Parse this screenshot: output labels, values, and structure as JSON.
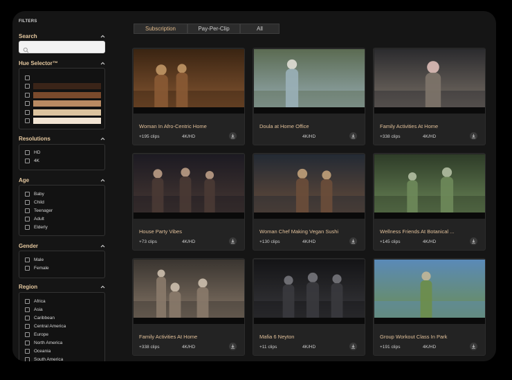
{
  "sidebar": {
    "title": "FILTERS",
    "search": {
      "label": "Search",
      "placeholder": "",
      "value": ""
    },
    "hue": {
      "label": "Hue Selector™",
      "swatches": [
        "#121212",
        "#3a2418",
        "#7a4a2c",
        "#b98a62",
        "#dcc39e",
        "#f1e4d3"
      ]
    },
    "resolutions": {
      "label": "Resolutions",
      "options": [
        "HD",
        "4K"
      ]
    },
    "age": {
      "label": "Age",
      "options": [
        "Baby",
        "Child",
        "Teenager",
        "Adult",
        "Elderly"
      ]
    },
    "gender": {
      "label": "Gender",
      "options": [
        "Male",
        "Female"
      ]
    },
    "region": {
      "label": "Region",
      "options": [
        "Africa",
        "Asia",
        "Caribbean",
        "Central America",
        "Europe",
        "North America",
        "Oceania",
        "South America"
      ]
    }
  },
  "tabs": [
    {
      "label": "Subscription",
      "active": true
    },
    {
      "label": "Pay-Per-Clip",
      "active": false
    },
    {
      "label": "All",
      "active": false
    }
  ],
  "cards": [
    {
      "title": "Woman In Afro-Centric Home",
      "clips": "+195 clips",
      "res": "4K/HD",
      "scene": [
        "#3a2412",
        "#8a5a34",
        "#c79c6a"
      ]
    },
    {
      "title": "Doula at Home Office",
      "clips": "",
      "res": "4K/HD",
      "scene": [
        "#5b6b52",
        "#9ab0b8",
        "#e8e4dc"
      ]
    },
    {
      "title": "Family Activities At Home",
      "clips": "+338 clips",
      "res": "4K/HD",
      "scene": [
        "#2b2b2e",
        "#7e746a",
        "#e8c6c0"
      ]
    },
    {
      "title": "House Party Vibes",
      "clips": "+73 clips",
      "res": "4K/HD",
      "scene": [
        "#1c1a22",
        "#4a3a34",
        "#c4a48c"
      ]
    },
    {
      "title": "Woman Chef Making Vegan Sushi",
      "clips": "+130 clips",
      "res": "4K/HD",
      "scene": [
        "#232a34",
        "#6b4e3a",
        "#c9a77e"
      ]
    },
    {
      "title": "Wellness Friends At Botanical ...",
      "clips": "+145 clips",
      "res": "4K/HD",
      "scene": [
        "#2e3c28",
        "#6e8a5a",
        "#b8c4a8"
      ]
    },
    {
      "title": "Family Activities At Home",
      "clips": "+338 clips",
      "res": "4K/HD",
      "scene": [
        "#3a3530",
        "#8a7a6a",
        "#d4c6b4"
      ]
    },
    {
      "title": "Mafia 6 Neyton",
      "clips": "+11 clips",
      "res": "4K/HD",
      "scene": [
        "#141416",
        "#3a3a3e",
        "#7a7a80"
      ]
    },
    {
      "title": "Group Workout Class In Park",
      "clips": "+191 clips",
      "res": "4K/HD",
      "scene": [
        "#5a8ab8",
        "#6d8d4a",
        "#c8b898"
      ]
    }
  ],
  "icons": {
    "search": "search-icon",
    "chevron": "chevron-up-icon",
    "download": "download-icon"
  },
  "colors": {
    "accent": "#e2c19b",
    "panel": "#151515",
    "card": "#232323"
  }
}
